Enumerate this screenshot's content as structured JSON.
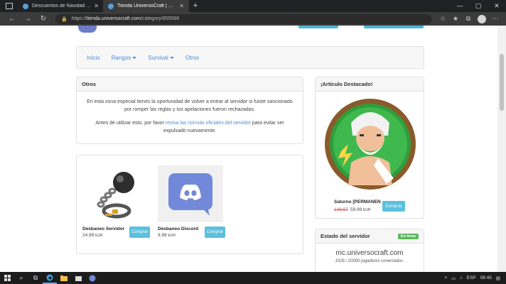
{
  "browser": {
    "tabs": [
      {
        "title": "Descuentos de Navidad y año nuevo",
        "active": false
      },
      {
        "title": "Tienda UniversoCraft | Otros",
        "active": true
      }
    ],
    "url_prefix": "https://",
    "url_domain": "tienda.universocraft.com",
    "url_path": "/category/855566"
  },
  "nav": {
    "items": [
      "Inicio",
      "Rangos",
      "Survival",
      "Otros"
    ]
  },
  "otros": {
    "heading": "Otros",
    "paragraph1": "En esta zona especial tienes la oportunidad de volver a entrar al servidor si fuiste sancionado por romper las reglas y tus apelaciones fueron rechazadas.",
    "paragraph2_pre": "Antes de utilizar esto, por favor ",
    "paragraph2_link": "revisa las normas oficiales del servidor",
    "paragraph2_post": " para evitar ser expulsado nuevamente."
  },
  "products": [
    {
      "name": "Desbaneo Servidor",
      "price": "24.99",
      "currency": "EUR",
      "button": "Comprar",
      "icon": "ball-and-chain-icon"
    },
    {
      "name": "Desbaneo Discord",
      "price": "9.99",
      "currency": "EUR",
      "button": "Comprar",
      "icon": "discord-icon"
    }
  ],
  "featured": {
    "heading": "¡Artículo Destacado!",
    "name": "Saturno [PERMANEN",
    "old_price": "149.97",
    "new_price": "59.99",
    "currency": "EUR",
    "button": "Comprar"
  },
  "status": {
    "heading": "Estado del servidor",
    "badge": "En línea",
    "ip": "mc.universocraft.com",
    "players": "1026 / 20000 jugadores conectados."
  },
  "taskbar": {
    "language": "ESP",
    "time": "08:45"
  },
  "colors": {
    "accent": "#5bc0de",
    "link": "#4a8cd6",
    "online": "#5cb85c",
    "old_price": "#d9534f"
  }
}
